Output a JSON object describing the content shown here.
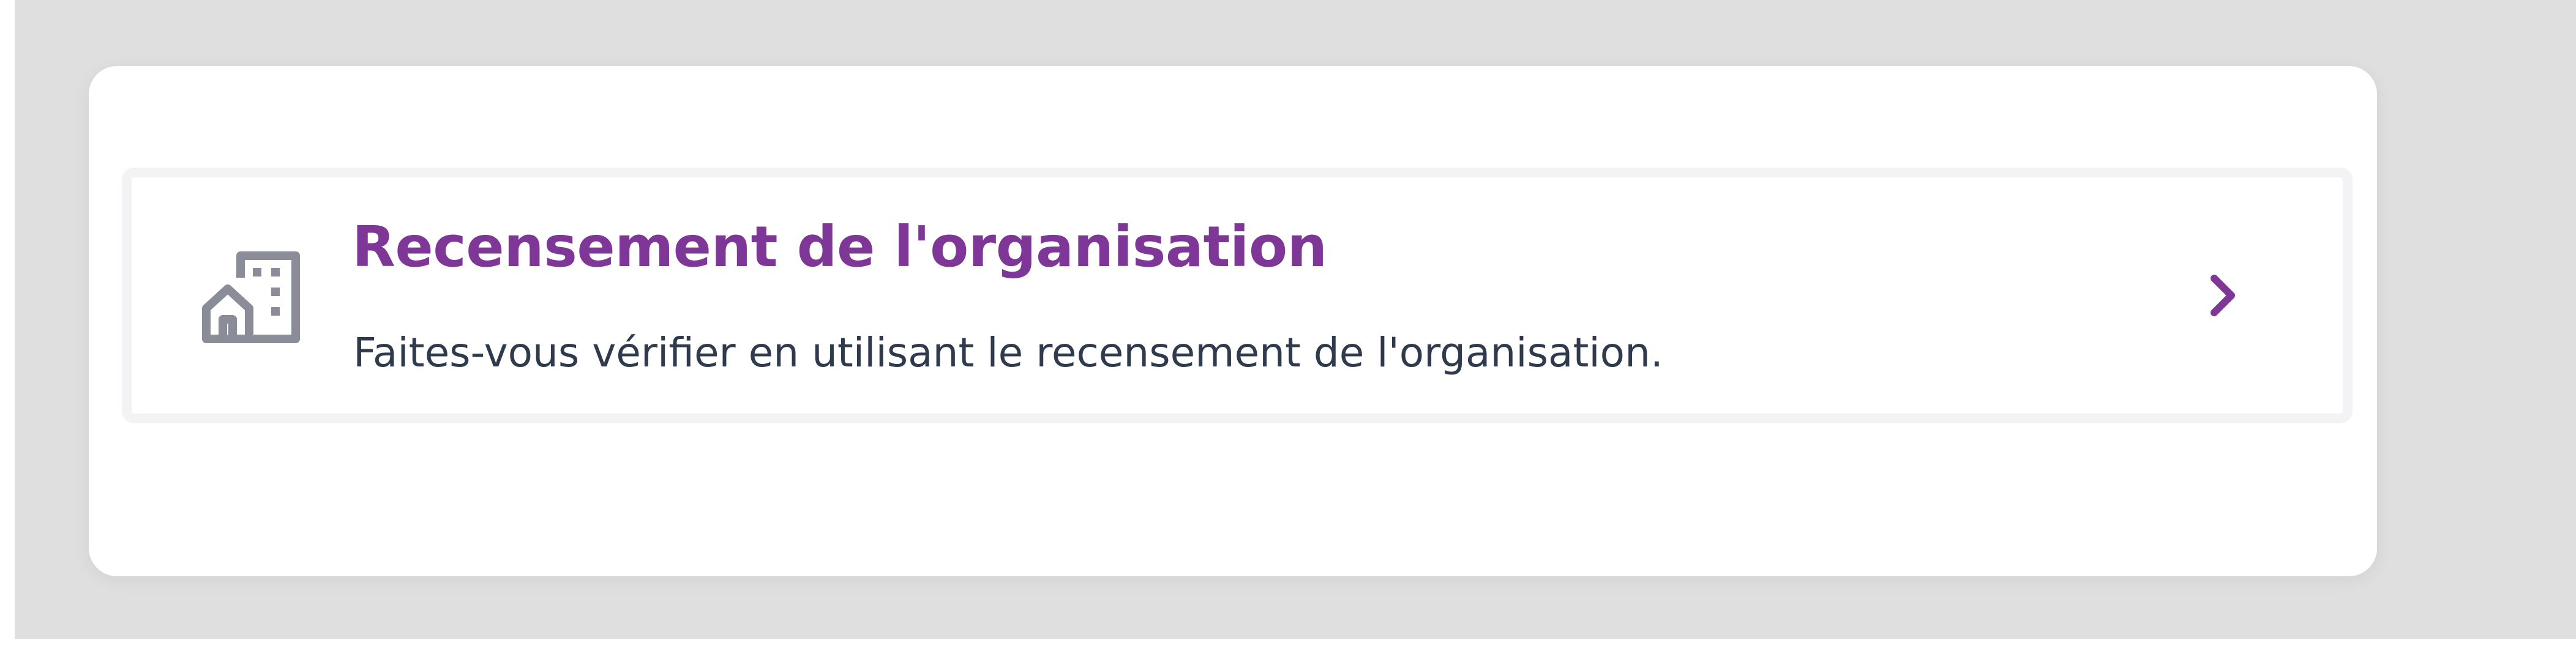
{
  "option": {
    "title": "Recensement de l'organisation",
    "description": "Faites-vous vérifier en utilisant le recensement de l'organisation.",
    "icon": "building-icon",
    "action_icon": "chevron-right-icon"
  },
  "colors": {
    "accent": "#7f3797",
    "text": "#2f3b4c",
    "icon": "#8a8d97",
    "backdrop": "#dfdfdf",
    "border": "#f3f3f6"
  }
}
